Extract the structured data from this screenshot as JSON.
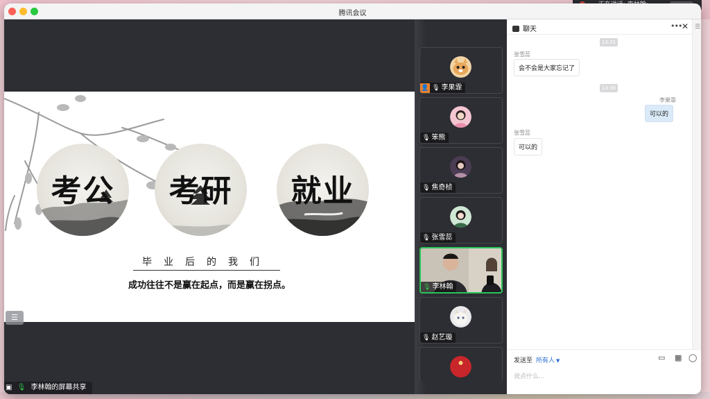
{
  "desktop": {
    "speaking_text": "正在讲话: 李林翰;"
  },
  "window": {
    "title": "腾讯会议"
  },
  "slide": {
    "circles": [
      "考公",
      "考研",
      "就业"
    ],
    "subtitle": "毕业后的我们",
    "motto": "成功往往不是赢在起点，而是赢在拐点。"
  },
  "share_label": "李林翰的屏幕共享",
  "participants": [
    {
      "name": "李果霏",
      "avatar": "cat",
      "host": true,
      "active": false
    },
    {
      "name": "笨熊",
      "avatar": "girl-pink",
      "host": false,
      "active": false
    },
    {
      "name": "焦奇桢",
      "avatar": "girl-dark",
      "host": false,
      "active": false
    },
    {
      "name": "张雪蕊",
      "avatar": "girl-green",
      "host": false,
      "active": false
    },
    {
      "name": "李林翰",
      "avatar": "video",
      "host": false,
      "active": true
    },
    {
      "name": "赵艺璇",
      "avatar": "kitten",
      "host": false,
      "active": false
    }
  ],
  "chat": {
    "title": "聊天",
    "messages": [
      {
        "time": "13:31"
      },
      {
        "sender": "张雪蕊",
        "text": "会不会是大家忘记了",
        "dir": "in"
      },
      {
        "time": "13:36"
      },
      {
        "sender": "李果霏",
        "text": "可以的",
        "dir": "out"
      },
      {
        "sender": "张雪蕊",
        "text": "可以的",
        "dir": "in"
      }
    ],
    "send_to_label": "发送至",
    "send_to_value": "所有人",
    "input_placeholder": "说点什么..."
  }
}
